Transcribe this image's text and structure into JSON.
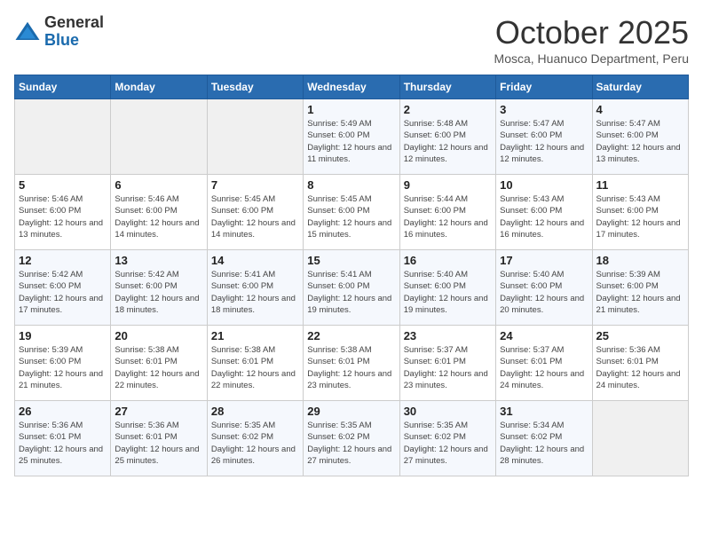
{
  "header": {
    "logo_general": "General",
    "logo_blue": "Blue",
    "month_title": "October 2025",
    "subtitle": "Mosca, Huanuco Department, Peru"
  },
  "days_of_week": [
    "Sunday",
    "Monday",
    "Tuesday",
    "Wednesday",
    "Thursday",
    "Friday",
    "Saturday"
  ],
  "weeks": [
    [
      {
        "day": "",
        "info": ""
      },
      {
        "day": "",
        "info": ""
      },
      {
        "day": "",
        "info": ""
      },
      {
        "day": "1",
        "info": "Sunrise: 5:49 AM\nSunset: 6:00 PM\nDaylight: 12 hours and 11 minutes."
      },
      {
        "day": "2",
        "info": "Sunrise: 5:48 AM\nSunset: 6:00 PM\nDaylight: 12 hours and 12 minutes."
      },
      {
        "day": "3",
        "info": "Sunrise: 5:47 AM\nSunset: 6:00 PM\nDaylight: 12 hours and 12 minutes."
      },
      {
        "day": "4",
        "info": "Sunrise: 5:47 AM\nSunset: 6:00 PM\nDaylight: 12 hours and 13 minutes."
      }
    ],
    [
      {
        "day": "5",
        "info": "Sunrise: 5:46 AM\nSunset: 6:00 PM\nDaylight: 12 hours and 13 minutes."
      },
      {
        "day": "6",
        "info": "Sunrise: 5:46 AM\nSunset: 6:00 PM\nDaylight: 12 hours and 14 minutes."
      },
      {
        "day": "7",
        "info": "Sunrise: 5:45 AM\nSunset: 6:00 PM\nDaylight: 12 hours and 14 minutes."
      },
      {
        "day": "8",
        "info": "Sunrise: 5:45 AM\nSunset: 6:00 PM\nDaylight: 12 hours and 15 minutes."
      },
      {
        "day": "9",
        "info": "Sunrise: 5:44 AM\nSunset: 6:00 PM\nDaylight: 12 hours and 16 minutes."
      },
      {
        "day": "10",
        "info": "Sunrise: 5:43 AM\nSunset: 6:00 PM\nDaylight: 12 hours and 16 minutes."
      },
      {
        "day": "11",
        "info": "Sunrise: 5:43 AM\nSunset: 6:00 PM\nDaylight: 12 hours and 17 minutes."
      }
    ],
    [
      {
        "day": "12",
        "info": "Sunrise: 5:42 AM\nSunset: 6:00 PM\nDaylight: 12 hours and 17 minutes."
      },
      {
        "day": "13",
        "info": "Sunrise: 5:42 AM\nSunset: 6:00 PM\nDaylight: 12 hours and 18 minutes."
      },
      {
        "day": "14",
        "info": "Sunrise: 5:41 AM\nSunset: 6:00 PM\nDaylight: 12 hours and 18 minutes."
      },
      {
        "day": "15",
        "info": "Sunrise: 5:41 AM\nSunset: 6:00 PM\nDaylight: 12 hours and 19 minutes."
      },
      {
        "day": "16",
        "info": "Sunrise: 5:40 AM\nSunset: 6:00 PM\nDaylight: 12 hours and 19 minutes."
      },
      {
        "day": "17",
        "info": "Sunrise: 5:40 AM\nSunset: 6:00 PM\nDaylight: 12 hours and 20 minutes."
      },
      {
        "day": "18",
        "info": "Sunrise: 5:39 AM\nSunset: 6:00 PM\nDaylight: 12 hours and 21 minutes."
      }
    ],
    [
      {
        "day": "19",
        "info": "Sunrise: 5:39 AM\nSunset: 6:00 PM\nDaylight: 12 hours and 21 minutes."
      },
      {
        "day": "20",
        "info": "Sunrise: 5:38 AM\nSunset: 6:01 PM\nDaylight: 12 hours and 22 minutes."
      },
      {
        "day": "21",
        "info": "Sunrise: 5:38 AM\nSunset: 6:01 PM\nDaylight: 12 hours and 22 minutes."
      },
      {
        "day": "22",
        "info": "Sunrise: 5:38 AM\nSunset: 6:01 PM\nDaylight: 12 hours and 23 minutes."
      },
      {
        "day": "23",
        "info": "Sunrise: 5:37 AM\nSunset: 6:01 PM\nDaylight: 12 hours and 23 minutes."
      },
      {
        "day": "24",
        "info": "Sunrise: 5:37 AM\nSunset: 6:01 PM\nDaylight: 12 hours and 24 minutes."
      },
      {
        "day": "25",
        "info": "Sunrise: 5:36 AM\nSunset: 6:01 PM\nDaylight: 12 hours and 24 minutes."
      }
    ],
    [
      {
        "day": "26",
        "info": "Sunrise: 5:36 AM\nSunset: 6:01 PM\nDaylight: 12 hours and 25 minutes."
      },
      {
        "day": "27",
        "info": "Sunrise: 5:36 AM\nSunset: 6:01 PM\nDaylight: 12 hours and 25 minutes."
      },
      {
        "day": "28",
        "info": "Sunrise: 5:35 AM\nSunset: 6:02 PM\nDaylight: 12 hours and 26 minutes."
      },
      {
        "day": "29",
        "info": "Sunrise: 5:35 AM\nSunset: 6:02 PM\nDaylight: 12 hours and 27 minutes."
      },
      {
        "day": "30",
        "info": "Sunrise: 5:35 AM\nSunset: 6:02 PM\nDaylight: 12 hours and 27 minutes."
      },
      {
        "day": "31",
        "info": "Sunrise: 5:34 AM\nSunset: 6:02 PM\nDaylight: 12 hours and 28 minutes."
      },
      {
        "day": "",
        "info": ""
      }
    ]
  ]
}
